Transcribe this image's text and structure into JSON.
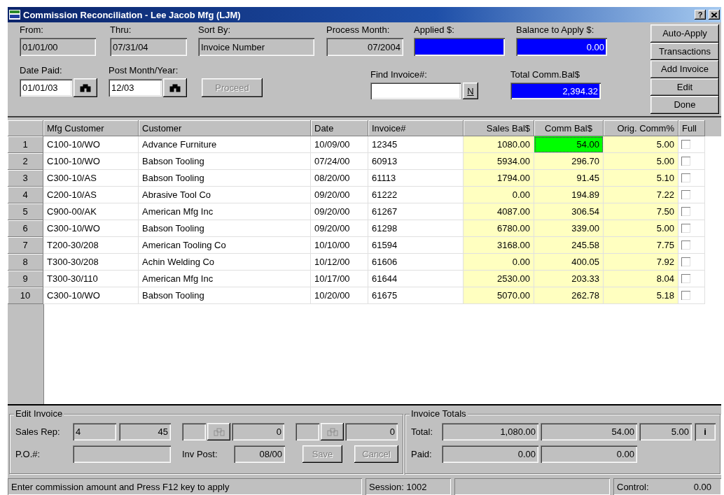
{
  "window": {
    "title": "Commission Reconciliation - Lee Jacob Mfg (LJM)",
    "help_button": "?"
  },
  "header": {
    "fields": [
      {
        "label": "From:",
        "value": "01/01/00",
        "kind": "readonly"
      },
      {
        "label": "Thru:",
        "value": "07/31/04",
        "kind": "readonly"
      },
      {
        "label": "Sort By:",
        "value": "Invoice Number",
        "kind": "readonly"
      },
      {
        "label": "Process Month:",
        "value": "07/2004",
        "kind": "readonly"
      },
      {
        "label": "Applied $:",
        "kind": "highlight"
      },
      {
        "label": "Balance to Apply $:",
        "value": "0.00",
        "kind": "highlight"
      }
    ],
    "date_paid": {
      "label": "Date Paid:",
      "value": "01/01/03"
    },
    "post_month": {
      "label": "Post Month/Year:",
      "value": "12/03"
    },
    "proceed_button": {
      "label": "Proceed",
      "disabled": true
    },
    "find_invoice": {
      "label": "Find Invoice#:",
      "button": "N"
    },
    "total_comm": {
      "label": "Total Comm.Bal$",
      "value": "2,394.32"
    }
  },
  "side_buttons": [
    "Auto-Apply",
    "Transactions",
    "Add Invoice",
    "Edit",
    "Done"
  ],
  "table": {
    "columns": [
      "Mfg Customer",
      "Customer",
      "Date",
      "Invoice#",
      "Sales Bal$",
      "Comm Bal$",
      "Orig. Comm%",
      "Full"
    ],
    "rows": [
      {
        "num": "1",
        "mfg_customer": "C100-10/WO",
        "customer": "Advance Furniture",
        "date": "10/09/00",
        "invoice": "12345",
        "sales_bal": "1080.00",
        "comm_bal": "54.00",
        "orig_comm": "5.00",
        "full": false,
        "selected": true
      },
      {
        "num": "2",
        "mfg_customer": "C100-10/WO",
        "customer": "Babson Tooling",
        "date": "07/24/00",
        "invoice": "60913",
        "sales_bal": "5934.00",
        "comm_bal": "296.70",
        "orig_comm": "5.00",
        "full": false,
        "selected": false
      },
      {
        "num": "3",
        "mfg_customer": "C300-10/AS",
        "customer": "Babson Tooling",
        "date": "08/20/00",
        "invoice": "61113",
        "sales_bal": "1794.00",
        "comm_bal": "91.45",
        "orig_comm": "5.10",
        "full": false,
        "selected": false
      },
      {
        "num": "4",
        "mfg_customer": "C200-10/AS",
        "customer": "Abrasive Tool Co",
        "date": "09/20/00",
        "invoice": "61222",
        "sales_bal": "0.00",
        "comm_bal": "194.89",
        "orig_comm": "7.22",
        "full": false,
        "selected": false
      },
      {
        "num": "5",
        "mfg_customer": "C900-00/AK",
        "customer": "American Mfg Inc",
        "date": "09/20/00",
        "invoice": "61267",
        "sales_bal": "4087.00",
        "comm_bal": "306.54",
        "orig_comm": "7.50",
        "full": false,
        "selected": false
      },
      {
        "num": "6",
        "mfg_customer": "C300-10/WO",
        "customer": "Babson Tooling",
        "date": "09/20/00",
        "invoice": "61298",
        "sales_bal": "6780.00",
        "comm_bal": "339.00",
        "orig_comm": "5.00",
        "full": false,
        "selected": false
      },
      {
        "num": "7",
        "mfg_customer": "T200-30/208",
        "customer": "American Tooling Co",
        "date": "10/10/00",
        "invoice": "61594",
        "sales_bal": "3168.00",
        "comm_bal": "245.58",
        "orig_comm": "7.75",
        "full": false,
        "selected": false
      },
      {
        "num": "8",
        "mfg_customer": "T300-30/208",
        "customer": "Achin Welding Co",
        "date": "10/12/00",
        "invoice": "61606",
        "sales_bal": "0.00",
        "comm_bal": "400.05",
        "orig_comm": "7.92",
        "full": false,
        "selected": false
      },
      {
        "num": "9",
        "mfg_customer": "T300-30/110",
        "customer": "American Mfg Inc",
        "date": "10/17/00",
        "invoice": "61644",
        "sales_bal": "2530.00",
        "comm_bal": "203.33",
        "orig_comm": "8.04",
        "full": false,
        "selected": false
      },
      {
        "num": "10",
        "mfg_customer": "C300-10/WO",
        "customer": "Babson Tooling",
        "date": "10/20/00",
        "invoice": "61675",
        "sales_bal": "5070.00",
        "comm_bal": "262.78",
        "orig_comm": "5.18",
        "full": false,
        "selected": false
      }
    ]
  },
  "edit_invoice": {
    "title": "Edit Invoice",
    "sales_rep_label": "Sales Rep:",
    "rep_fields": [
      "4",
      "45"
    ],
    "rep_lookups": [
      {
        "amount": "0",
        "disabled": true
      },
      {
        "amount": "0",
        "disabled": true
      }
    ],
    "po_label": "P.O.#:",
    "inv_post_label": "Inv Post:",
    "inv_post": "08/00",
    "buttons": [
      {
        "label": "Save",
        "disabled": true
      },
      {
        "label": "Cancel",
        "disabled": true
      }
    ]
  },
  "invoice_totals": {
    "title": "Invoice Totals",
    "total_label": "Total:",
    "totals": [
      "1,080.00",
      "54.00",
      "5.00"
    ],
    "info_button": "i",
    "paid_label": "Paid:",
    "paid": [
      "0.00",
      "0.00"
    ]
  },
  "status_bar": {
    "message": "Enter commission amount and Press F12 key to apply",
    "session": "Session: 1002",
    "control_label": "Control:",
    "control_value": "0.00"
  }
}
